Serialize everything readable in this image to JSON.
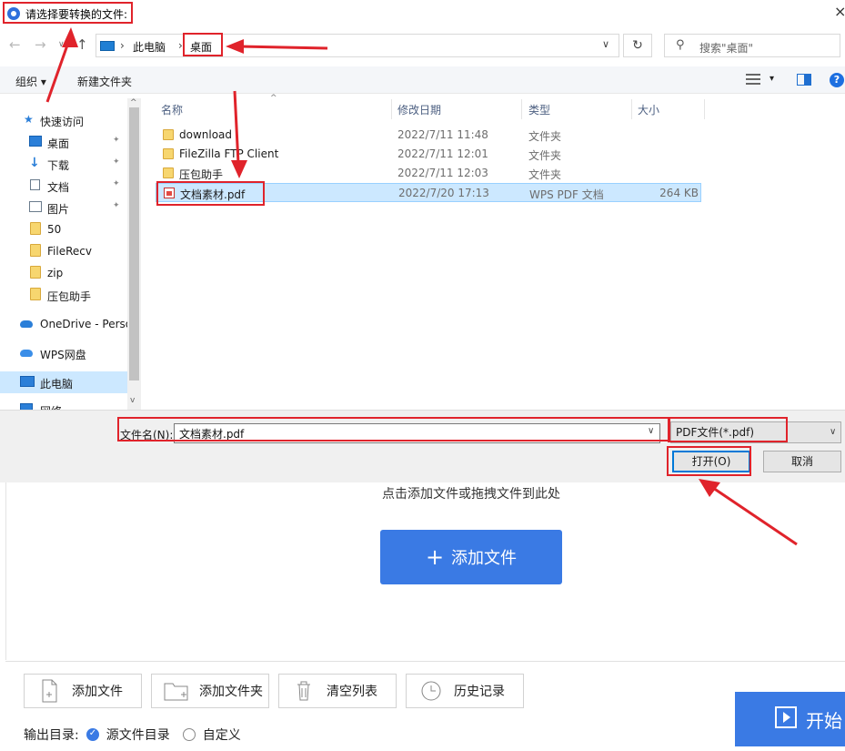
{
  "dialog": {
    "title": "请选择要转换的文件:",
    "close_symbol": "×",
    "nav": {
      "back_symbol": "←",
      "forward_symbol": "→",
      "dropdown_symbol": "∨",
      "up_symbol": "↑",
      "breadcrumb": [
        "此电脑",
        "桌面"
      ],
      "crumb_separator": "›",
      "refresh_symbol": "↻",
      "search_placeholder": "搜索\"桌面\""
    },
    "commands": {
      "organize": "组织 ▾",
      "new_folder": "新建文件夹",
      "view_dropdown": "▾",
      "help": "?"
    },
    "sidebar": {
      "items": [
        {
          "label": "快速访问",
          "icon": "star-icon",
          "pinned": false
        },
        {
          "label": "桌面",
          "icon": "desktop-icon",
          "pinned": true
        },
        {
          "label": "下载",
          "icon": "download-icon",
          "pinned": true
        },
        {
          "label": "文档",
          "icon": "document-icon",
          "pinned": true
        },
        {
          "label": "图片",
          "icon": "picture-icon",
          "pinned": true
        },
        {
          "label": "50",
          "icon": "folder-icon",
          "pinned": false
        },
        {
          "label": "FileRecv",
          "icon": "folder-icon",
          "pinned": false
        },
        {
          "label": "zip",
          "icon": "folder-icon",
          "pinned": false
        },
        {
          "label": "压包助手",
          "icon": "folder-icon",
          "pinned": false
        },
        {
          "label": "OneDrive - Perso",
          "icon": "onedrive-icon",
          "pinned": false
        },
        {
          "label": "WPS网盘",
          "icon": "cloud-icon",
          "pinned": false
        },
        {
          "label": "此电脑",
          "icon": "computer-icon",
          "pinned": false,
          "selected": true
        },
        {
          "label": "网络",
          "icon": "network-icon",
          "pinned": false
        }
      ],
      "pin_symbol": "📌"
    },
    "columns": {
      "sort_symbol": "^",
      "name": "名称",
      "date": "修改日期",
      "type": "类型",
      "size": "大小"
    },
    "files": [
      {
        "name": "download",
        "date": "2022/7/11 11:48",
        "type": "文件夹",
        "size": "",
        "icon": "folder-icon"
      },
      {
        "name": "FileZilla FTP Client",
        "date": "2022/7/11 12:01",
        "type": "文件夹",
        "size": "",
        "icon": "folder-icon"
      },
      {
        "name": "压包助手",
        "date": "2022/7/11 12:03",
        "type": "文件夹",
        "size": "",
        "icon": "folder-icon"
      },
      {
        "name": "文档素材.pdf",
        "date": "2022/7/20 17:13",
        "type": "WPS PDF 文档",
        "size": "264 KB",
        "icon": "pdf-icon",
        "selected": true
      }
    ],
    "filename_label": "文件名(N):",
    "filename_value": "文档素材.pdf",
    "filetype": "PDF文件(*.pdf)",
    "open_button": "打开(O)",
    "cancel_button": "取消",
    "dropdown_symbol": "∨",
    "scroll_up": "^",
    "scroll_down": "v"
  },
  "app": {
    "drop_hint": "点击添加文件或拖拽文件到此处",
    "add_file_big": "添加文件",
    "add_symbol": "+",
    "toolbar": {
      "add_file": "添加文件",
      "add_folder": "添加文件夹",
      "clear_list": "清空列表",
      "history": "历史记录"
    },
    "output_dir_label": "输出目录:",
    "output_options": [
      "源文件目录",
      "自定义"
    ],
    "start_button": "开始"
  },
  "colors": {
    "accent": "#3a7ae4",
    "annotation": "#e0232b",
    "selection": "#cce8ff"
  }
}
